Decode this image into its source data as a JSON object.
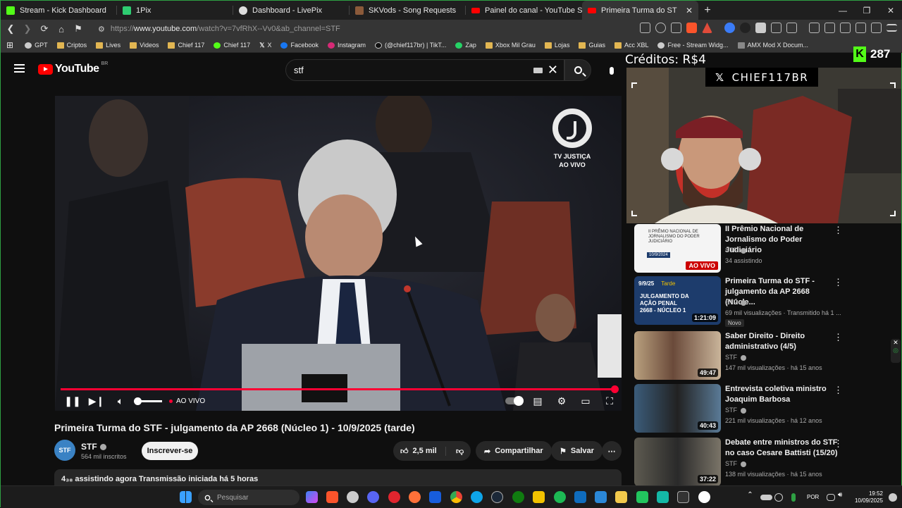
{
  "tabs": [
    {
      "label": "Stream - Kick Dashboard",
      "color": "#53fc18"
    },
    {
      "label": "1Pix",
      "color": "#2ecc71"
    },
    {
      "label": "Dashboard - LivePix",
      "color": "#dddddd"
    },
    {
      "label": "SKVods - Song Requests",
      "color": "#a0522d"
    },
    {
      "label": "Painel do canal - YouTube Studio",
      "color": "#ff0000"
    },
    {
      "label": "Primeira Turma do STF - julgame",
      "color": "#ff0000",
      "active": true
    }
  ],
  "address": {
    "prefix": "https://",
    "host": "www.youtube.com",
    "path": "/watch?v=7vfRhX--Vv0&ab_channel=STF"
  },
  "bookmarks": [
    "GPT",
    "Criptos",
    "Lives",
    "Videos",
    "Chief 117",
    "Chief 117",
    "X",
    "Facebook",
    "Instagram",
    "(@chief117br) | TikT...",
    "Zap",
    "Xbox Mil Grau",
    "Lojas",
    "Guias",
    "Acc XBL",
    "Free - Stream Widg...",
    "AMX Mod X Docum..."
  ],
  "youtube": {
    "logo": "YouTube",
    "country": "BR",
    "query": "stf"
  },
  "player": {
    "tv_logo_line1": "TV JUSTIÇA",
    "tv_logo_line2": "AO VIVO",
    "live_label": "AO VIVO",
    "progress": 1.0
  },
  "video": {
    "title": "Primeira Turma do STF - julgamento da AP 2668 (Núcleo 1) - 10/9/2025 (tarde)",
    "channel": "STF",
    "channel_avatar": "STF",
    "subscribers": "564 mil inscritos",
    "subscribe": "Inscrever-se",
    "likes": "2,5 mil",
    "share": "Compartilhar",
    "save": "Salvar",
    "description": "4₃₈ assistindo agora  Transmissão iniciada há 5 horas"
  },
  "overlay": {
    "credits": "Créditos: R$4",
    "kick_count": "287",
    "handle": "CHIEF117BR"
  },
  "recommendations": [
    {
      "title": "II Prêmio Nacional de Jornalismo do Poder Judiciário",
      "channel": "STF",
      "meta": "34 assistindo",
      "badge_live": "AO VIVO",
      "thumb": "#f4f4f4"
    },
    {
      "title": "Primeira Turma do STF - julgamento da AP 2668 (Núcle...",
      "channel": "STF",
      "meta": "69 mil visualizações · Transmitido há 1 ...",
      "duration": "1:21:09",
      "badge": "Novo",
      "thumb": "#1d3c6c"
    },
    {
      "title": "Saber Direito - Direito administrativo (4/5)",
      "channel": "STF",
      "meta": "147 mil visualizações · há 15 anos",
      "duration": "49:47",
      "thumb": "#6a4a3a"
    },
    {
      "title": "Entrevista coletiva ministro Joaquim Barbosa",
      "channel": "STF",
      "meta": "221 mil visualizações · há 12 anos",
      "duration": "40:43",
      "thumb": "#3b5c7a"
    },
    {
      "title": "Debate entre ministros do STF no caso Cesare Battisti (15/20)",
      "channel": "STF",
      "meta": "138 mil visualizações · há 15 anos",
      "duration": "37:22",
      "thumb": "#5d5a50"
    }
  ],
  "thumb_text": {
    "jornalismo": "II PRÊMIO NACIONAL DE JORNALISMO DO PODER JUDICIÁRIO",
    "date": "10/9/2024",
    "tarde_date": "9/9/25",
    "tarde": "Tarde",
    "julgamento": "JULGAMENTO DA AÇÃO PENAL 2668 - NÚCLEO 1"
  },
  "taskbar": {
    "search": "Pesquisar",
    "lang": "POR",
    "time": "19:52",
    "date": "10/09/2025"
  }
}
